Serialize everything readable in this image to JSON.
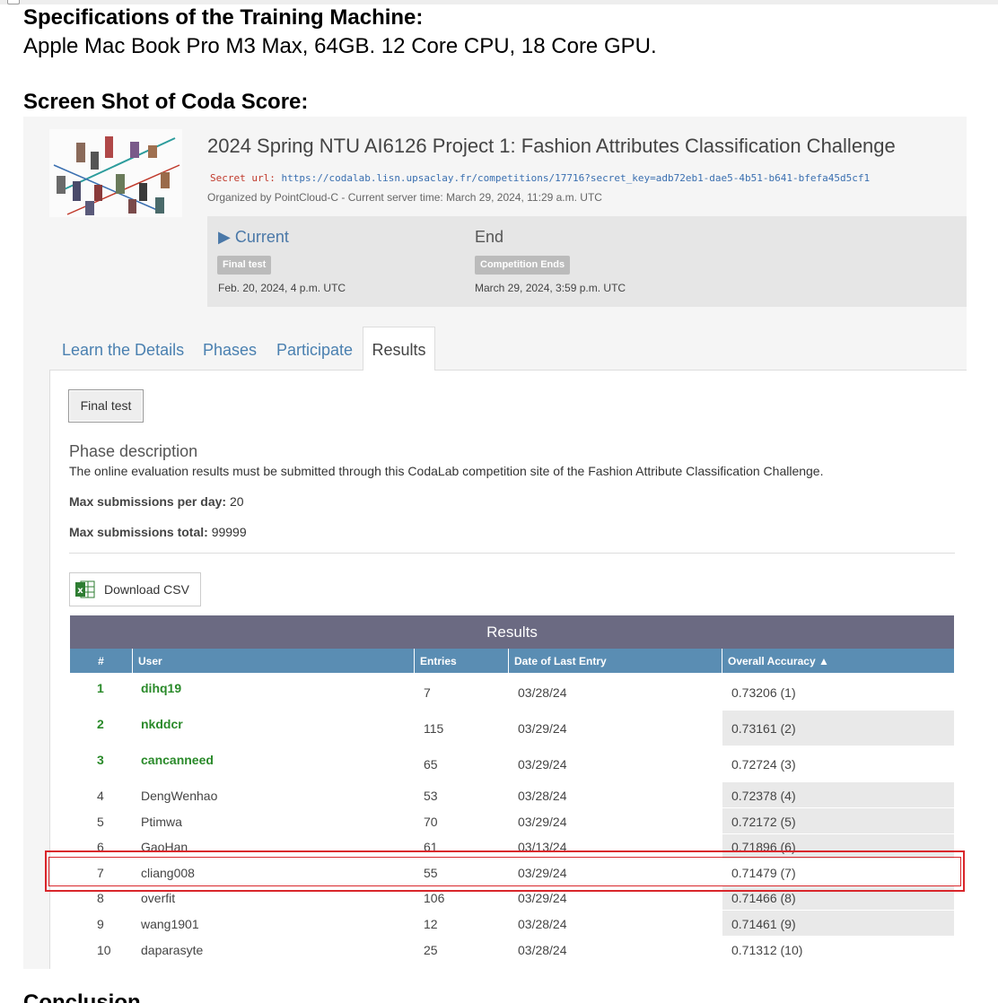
{
  "doc": {
    "spec_heading": "Specifications of the Training Machine:",
    "spec_text": "Apple Mac Book Pro M3 Max, 64GB. 12 Core CPU, 18 Core GPU.",
    "screenshot_heading": "Screen Shot of Coda Score:",
    "next_heading": "Conclusion"
  },
  "competition": {
    "title": "2024 Spring NTU AI6126 Project 1: Fashion Attributes Classification Challenge",
    "secret_label": "Secret url:",
    "secret_url": "https://codalab.lisn.upsaclay.fr/competitions/17716?secret_key=adb72eb1-dae5-4b51-b641-bfefa45d5cf1",
    "organizer": "Organized by PointCloud-C - Current server time: March 29, 2024, 11:29 a.m. UTC"
  },
  "phases": {
    "current_label": "▶ Current",
    "current_badge": "Final test",
    "current_date": "Feb. 20, 2024, 4 p.m. UTC",
    "end_label": "End",
    "end_badge": "Competition Ends",
    "end_date": "March 29, 2024, 3:59 p.m. UTC"
  },
  "tabs": [
    "Learn the Details",
    "Phases",
    "Participate",
    "Results"
  ],
  "results_tab": {
    "phase_button": "Final test",
    "phase_desc_title": "Phase description",
    "phase_desc": "The online evaluation results must be submitted through this CodaLab competition site of the Fashion Attribute Classification Challenge.",
    "max_day_label": "Max submissions per day:",
    "max_day_value": " 20",
    "max_total_label": "Max submissions total:",
    "max_total_value": " 99999",
    "download_label": "Download CSV"
  },
  "table": {
    "title": "Results",
    "columns": [
      "#",
      "User",
      "Entries",
      "Date of Last Entry",
      "Overall Accuracy ▲"
    ],
    "rows": [
      {
        "rank": "1",
        "user": "dihq19",
        "entries": "7",
        "date": "03/28/24",
        "accuracy": "0.73206 (1)"
      },
      {
        "rank": "2",
        "user": "nkddcr",
        "entries": "115",
        "date": "03/29/24",
        "accuracy": "0.73161 (2)"
      },
      {
        "rank": "3",
        "user": "cancanneed",
        "entries": "65",
        "date": "03/29/24",
        "accuracy": "0.72724 (3)"
      },
      {
        "rank": "4",
        "user": "DengWenhao",
        "entries": "53",
        "date": "03/28/24",
        "accuracy": "0.72378 (4)"
      },
      {
        "rank": "5",
        "user": "Ptimwa",
        "entries": "70",
        "date": "03/29/24",
        "accuracy": "0.72172 (5)"
      },
      {
        "rank": "6",
        "user": "GaoHan",
        "entries": "61",
        "date": "03/13/24",
        "accuracy": "0.71896 (6)"
      },
      {
        "rank": "7",
        "user": "cliang008",
        "entries": "55",
        "date": "03/29/24",
        "accuracy": "0.71479 (7)"
      },
      {
        "rank": "8",
        "user": "overfit",
        "entries": "106",
        "date": "03/29/24",
        "accuracy": "0.71466 (8)"
      },
      {
        "rank": "9",
        "user": "wang1901",
        "entries": "12",
        "date": "03/28/24",
        "accuracy": "0.71461 (9)"
      },
      {
        "rank": "10",
        "user": "daparasyte",
        "entries": "25",
        "date": "03/28/24",
        "accuracy": "0.71312 (10)"
      }
    ]
  }
}
